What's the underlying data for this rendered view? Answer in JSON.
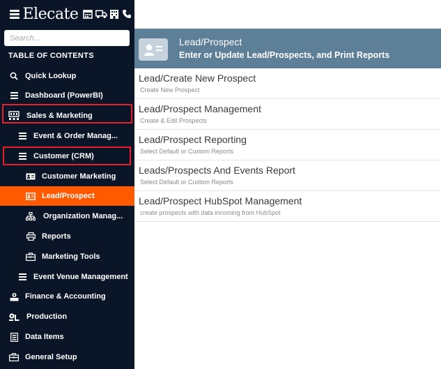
{
  "app": {
    "brand": "Elecate"
  },
  "sidebar": {
    "search_placeholder": "Search...",
    "toc_title": "TABLE OF CONTENTS",
    "items": [
      {
        "label": "Quick Lookup"
      },
      {
        "label": "Dashboard (PowerBI)"
      },
      {
        "label": "Sales & Marketing"
      },
      {
        "label": "Event & Order Manag..."
      },
      {
        "label": "Customer (CRM)"
      },
      {
        "label": "Customer Marketing"
      },
      {
        "label": "Lead/Prospect"
      },
      {
        "label": "Organization Manag..."
      },
      {
        "label": "Reports"
      },
      {
        "label": "Marketing Tools"
      },
      {
        "label": "Event Venue Management"
      },
      {
        "label": "Finance & Accounting"
      },
      {
        "label": "Production"
      },
      {
        "label": "Data Items"
      },
      {
        "label": "General Setup"
      }
    ]
  },
  "header": {
    "title": "Lead/Prospect",
    "subtitle": "Enter or Update Lead/Prospects, and Print Reports"
  },
  "rows": [
    {
      "title": "Lead/Create New Prospect",
      "subtitle": "Create New Prospect"
    },
    {
      "title": "Lead/Prospect Management",
      "subtitle": "Create & Edit Prospects"
    },
    {
      "title": "Lead/Prospect Reporting",
      "subtitle": "Select Default or Custom Reports"
    },
    {
      "title": "Leads/Prospects And Events Report",
      "subtitle": "Select Default or Custom Reports"
    },
    {
      "title": "Lead/Prospect HubSpot Management",
      "subtitle": "create prospects with data incoming from HubSpot"
    }
  ],
  "colors": {
    "sidebar_bg": "#0a1628",
    "active_bg": "#ff5a00",
    "header_bg": "#5d7f98",
    "highlight_border": "#e8202a"
  }
}
